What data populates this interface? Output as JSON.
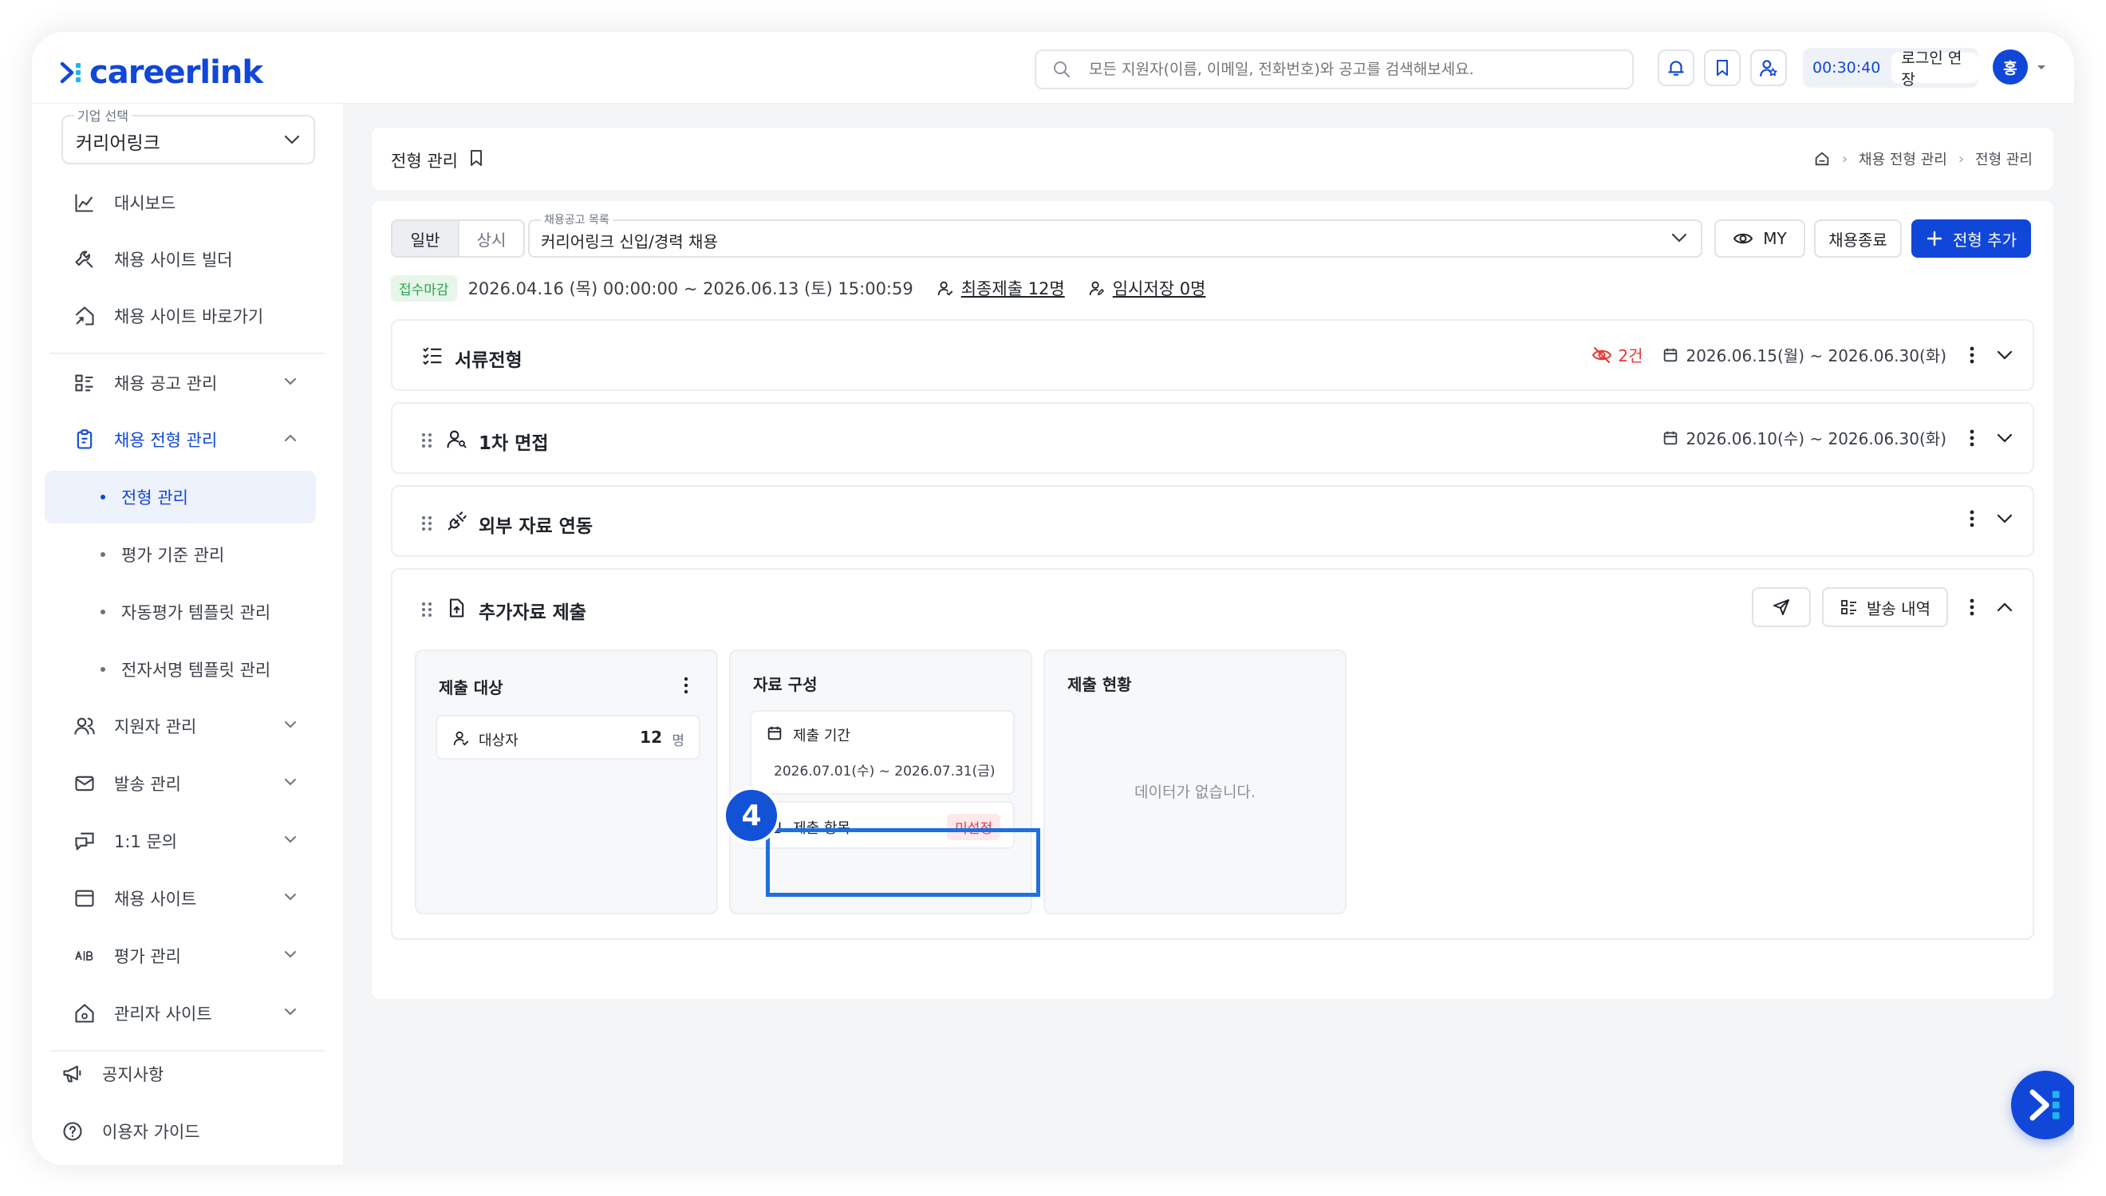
{
  "app": {
    "logo_text": "careerlink"
  },
  "topbar": {
    "search_placeholder": "모든 지원자(이름, 이메일, 전화번호)와 공고를 검색해보세요.",
    "timer": "00:30:40",
    "extend_label": "로그인 연장",
    "avatar_initial": "홍"
  },
  "sidebar": {
    "company_label": "기업 선택",
    "company_value": "커리어링크",
    "items": [
      {
        "label": "대시보드"
      },
      {
        "label": "채용 사이트 빌더"
      },
      {
        "label": "채용 사이트 바로가기"
      },
      {
        "label": "채용 공고 관리"
      },
      {
        "label": "채용 전형 관리"
      },
      {
        "label": "지원자 관리"
      },
      {
        "label": "발송 관리"
      },
      {
        "label": "1:1 문의"
      },
      {
        "label": "채용 사이트"
      },
      {
        "label": "평가 관리"
      },
      {
        "label": "관리자 사이트"
      },
      {
        "label": "공지사항"
      },
      {
        "label": "이용자 가이드"
      }
    ],
    "subitems": [
      {
        "label": "전형 관리"
      },
      {
        "label": "평가 기준 관리"
      },
      {
        "label": "자동평가 템플릿 관리"
      },
      {
        "label": "전자서명 템플릿 관리"
      }
    ]
  },
  "header": {
    "title": "전형 관리",
    "breadcrumb": [
      "채용 전형 관리",
      "전형 관리"
    ]
  },
  "toolbar": {
    "tabs": [
      "일반",
      "상시"
    ],
    "job_label": "채용공고 목록",
    "job_value": "커리어링크 신입/경력 채용",
    "my_label": "MY",
    "close_label": "채용종료",
    "add_label": "전형 추가"
  },
  "status": {
    "badge": "접수마감",
    "period": "2026.04.16 (목) 00:00:00 ~ 2026.06.13 (토) 15:00:59",
    "final_submit": "최종제출 12명",
    "temp_save": "임시저장 0명"
  },
  "stages": [
    {
      "title": "서류전형",
      "hidden_count": "2건",
      "date_range": "2026.06.15(월) ~ 2026.06.30(화)"
    },
    {
      "title": "1차 면접",
      "date_range": "2026.06.10(수) ~ 2026.06.30(화)"
    },
    {
      "title": "외부 자료 연동"
    },
    {
      "title": "추가자료 제출",
      "history_label": "발송 내역"
    }
  ],
  "panels": {
    "target": {
      "title": "제출 대상",
      "row_label": "대상자",
      "row_count": "12",
      "row_unit": "명"
    },
    "composition": {
      "title": "자료 구성",
      "period_label": "제출 기간",
      "period_value": "2026.07.01(수) ~ 2026.07.31(금)",
      "items_label": "제출 항목",
      "items_status": "미설정"
    },
    "status": {
      "title": "제출 현황",
      "empty": "데이터가 없습니다."
    }
  },
  "annotation": {
    "step": "4"
  },
  "colors": {
    "brand": "#1147d9",
    "danger": "#e53935",
    "success": "#2fa34a"
  }
}
